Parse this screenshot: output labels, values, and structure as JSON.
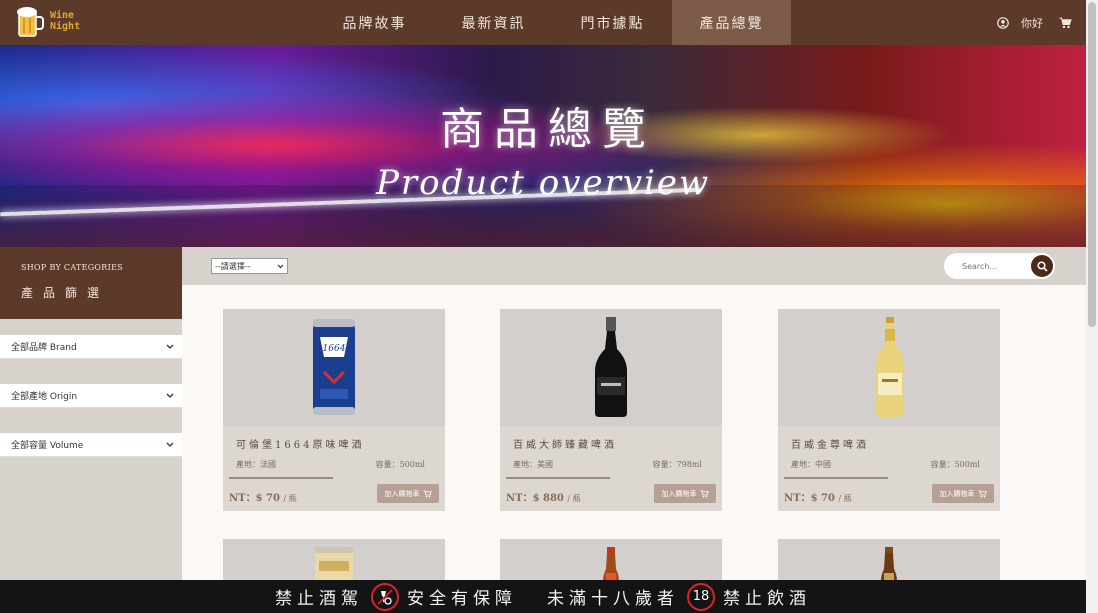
{
  "brand": {
    "logo_text_line1": "Wine",
    "logo_text_line2": "Night",
    "icon": "beer-mug-icon"
  },
  "nav": {
    "items": [
      {
        "label": "品牌故事"
      },
      {
        "label": "最新資訊"
      },
      {
        "label": "門市據點"
      },
      {
        "label": "產品總覽"
      }
    ],
    "active_index": 3,
    "greeting": "你好",
    "user_icon": "user-icon",
    "cart_icon": "cart-icon"
  },
  "banner": {
    "title_zh": "商品總覽",
    "title_en": "Product overview"
  },
  "sidebar": {
    "heading_en": "SHOP BY CATEGORIES",
    "heading_zh": "產品篩選",
    "filters": [
      {
        "label": "全部品牌 Brand"
      },
      {
        "label": "全部產地 Origin"
      },
      {
        "label": "全部容量 Volume"
      }
    ]
  },
  "toolbar": {
    "sort_value": "--請選擇--",
    "search_placeholder": "Search..."
  },
  "products": [
    {
      "name": "可倫堡1664原味啤酒",
      "origin": "產地：法國",
      "volume": "容量：500ml",
      "price": "NT：$ 70",
      "unit": "/ 瓶",
      "cart_label": "加入購物車",
      "image": "blue-beer-can"
    },
    {
      "name": "百威大師臻藏啤酒",
      "origin": "產地：美國",
      "volume": "容量：798ml",
      "price": "NT：$ 880",
      "unit": "/ 瓶",
      "cart_label": "加入購物車",
      "image": "black-champagne-bottle"
    },
    {
      "name": "百威金尊啤酒",
      "origin": "產地：中國",
      "volume": "容量：500ml",
      "price": "NT：$ 70",
      "unit": "/ 瓶",
      "cart_label": "加入購物車",
      "image": "gold-beer-bottle"
    }
  ],
  "footer": {
    "text1": "禁止酒駕",
    "text2": "安全有保障",
    "text3": "未滿十八歲者",
    "badge": "18",
    "text4": "禁止飲酒"
  },
  "colors": {
    "nav_bg": "#5b3a2a",
    "nav_active": "#7c5a48",
    "accent": "#e0a82e",
    "footer_bg": "#151414"
  }
}
